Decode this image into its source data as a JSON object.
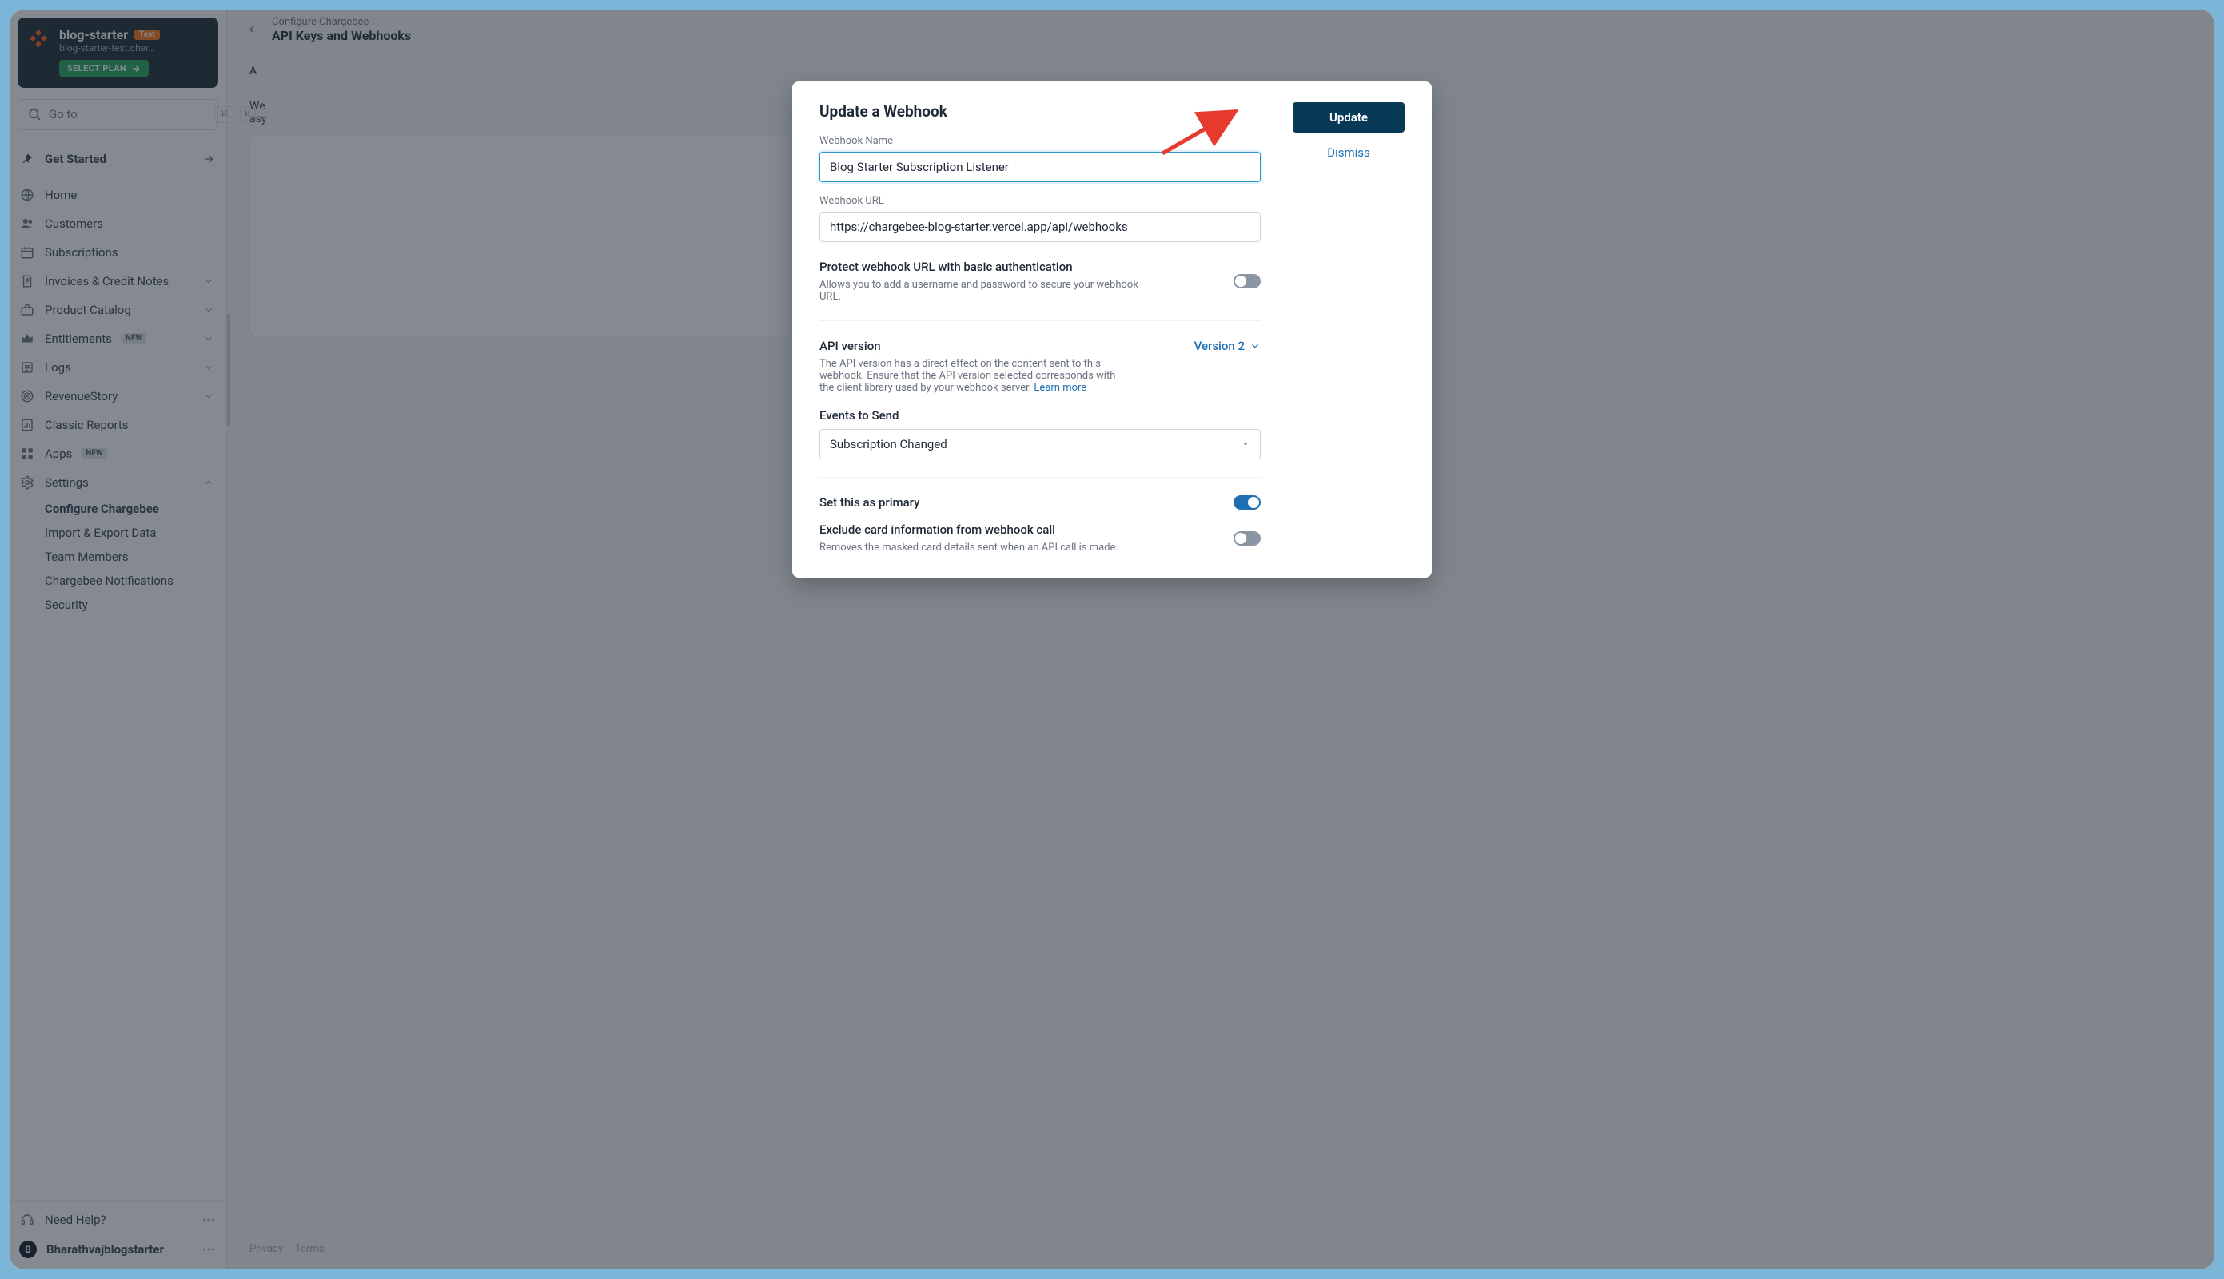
{
  "site": {
    "name": "blog-starter",
    "tag": "Test",
    "sub": "blog-starter-test.char…",
    "select_plan": "SELECT PLAN"
  },
  "search": {
    "placeholder": "Go to",
    "kbd1": "⌘",
    "kbd2": "K"
  },
  "nav": {
    "get_started": "Get Started",
    "home": "Home",
    "customers": "Customers",
    "subscriptions": "Subscriptions",
    "invoices": "Invoices & Credit Notes",
    "product_catalog": "Product Catalog",
    "entitlements": "Entitlements",
    "new_badge": "NEW",
    "logs": "Logs",
    "revenue_story": "RevenueStory",
    "classic_reports": "Classic Reports",
    "apps": "Apps",
    "settings": "Settings",
    "settings_children": {
      "configure": "Configure Chargebee",
      "import_export": "Import & Export Data",
      "team_members": "Team Members",
      "notifications": "Chargebee Notifications",
      "security": "Security"
    }
  },
  "footer": {
    "need_help": "Need Help?",
    "user_initial": "B",
    "user_name": "Bharathvajblogstarter"
  },
  "topbar": {
    "breadcrumb": "Configure Chargebee",
    "title": "API Keys and Webhooks"
  },
  "note_a": "A",
  "note_line1": "We",
  "note_line2": "asy",
  "content_footer": {
    "privacy": "Privacy",
    "terms": "Terms"
  },
  "modal": {
    "title": "Update a Webhook",
    "update": "Update",
    "dismiss": "Dismiss",
    "name_label": "Webhook Name",
    "name_value": "Blog Starter Subscription Listener",
    "url_label": "Webhook URL",
    "url_value": "https://chargebee-blog-starter.vercel.app/api/webhooks",
    "protect_title": "Protect webhook URL with basic authentication",
    "protect_help": "Allows you to add a username and password to secure your webhook URL.",
    "api_version_label": "API version",
    "api_version_value": "Version 2",
    "api_version_help": "The API version has a direct effect on the content sent to this webhook. Ensure that the API version selected corresponds with the client library used by your webhook server. ",
    "learn_more": "Learn more",
    "events_label": "Events to Send",
    "events_value": "Subscription Changed",
    "primary_label": "Set this as primary",
    "exclude_label": "Exclude card information from webhook call",
    "exclude_help": "Removes the masked card details sent when an API call is made."
  }
}
